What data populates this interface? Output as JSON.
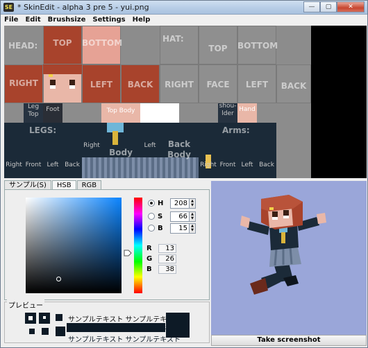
{
  "window": {
    "title": "* SkinEdit - alpha 3 pre 5 - yui.png",
    "app_icon_text": "SE",
    "controls": [
      "—",
      "▢",
      "✕"
    ]
  },
  "menu": [
    "File",
    "Edit",
    "Brushsize",
    "Settings",
    "Help"
  ],
  "skin": {
    "head_label": "HEAD:",
    "hat_label": "HAT:",
    "head_faces": [
      "TOP",
      "BOTTOM",
      "RIGHT",
      "FACE",
      "LEFT",
      "BACK"
    ],
    "hat_faces": [
      "TOP",
      "BOTTOM",
      "RIGHT",
      "FACE",
      "LEFT",
      "BACK"
    ],
    "leg_top": "Leg Top",
    "foot": "Foot",
    "top_body": "Top Body",
    "shoulder": "shou- lder",
    "hand": "Hand",
    "legs_label": "LEGS:",
    "body_label": "Body",
    "back_body": "Back Body",
    "arms_label": "Arms:",
    "leg_faces": [
      "Right",
      "Front",
      "Left",
      "Back"
    ],
    "body_sides": [
      "Right",
      "Left"
    ],
    "arm_faces": [
      "Right",
      "Front",
      "Left",
      "Back"
    ]
  },
  "chooser": {
    "tabs": [
      "サンプル(S)",
      "HSB",
      "RGB"
    ],
    "active_tab": "HSB",
    "hsb": [
      {
        "label": "H",
        "value": "208",
        "selected": true
      },
      {
        "label": "S",
        "value": "66",
        "selected": false
      },
      {
        "label": "B",
        "value": "15",
        "selected": false
      }
    ],
    "rgb": [
      {
        "label": "R",
        "value": "13"
      },
      {
        "label": "G",
        "value": "26"
      },
      {
        "label": "B",
        "value": "38"
      }
    ],
    "current_color": "#0d1a26"
  },
  "preview": {
    "title": "プレビュー",
    "sample_text": "サンプルテキスト サンプルテキスト"
  },
  "view3d": {
    "screenshot_button": "Take screenshot",
    "background": "#9aa6d9"
  }
}
